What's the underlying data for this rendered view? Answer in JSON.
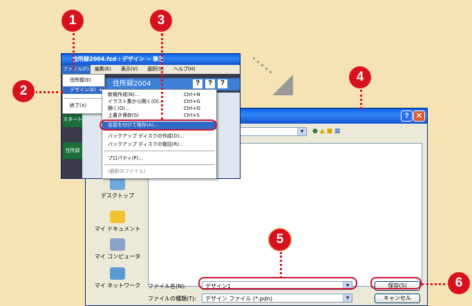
{
  "colors": {
    "background": "#f6e3b4",
    "accent_red": "#d8121c",
    "titlebar_blue": "#1553d2"
  },
  "badges": [
    "1",
    "2",
    "3",
    "4",
    "5",
    "6"
  ],
  "app": {
    "title": "住所録2004.fzd : デザイン − 筆王",
    "menubar": [
      "ファイル(F)",
      "編集(E)",
      "表示(V)",
      "選択(S)",
      "ヘルプ(H)"
    ],
    "brand": "住所録2004",
    "sidebar": [
      "スタート",
      "住所録"
    ]
  },
  "file_menu": {
    "items": [
      "住所録(E)",
      "デザイン(E)",
      "終了(X)"
    ]
  },
  "submenu": {
    "items": [
      {
        "label": "新規作成(N)...",
        "shortcut": "Ctrl+N"
      },
      {
        "label": "イラスト集から開く(O)...",
        "shortcut": "Ctrl+G"
      },
      {
        "label": "開く(O)...",
        "shortcut": "Ctrl+O"
      },
      {
        "label": "上書き保存(S)",
        "shortcut": "Ctrl+S"
      },
      {
        "label": "名前を付けて保存(A)...",
        "shortcut": ""
      },
      {
        "label": "バックアップ ディスクの作成(D)...",
        "shortcut": ""
      },
      {
        "label": "バックアップ ディスクの復旧(R)...",
        "shortcut": ""
      },
      {
        "label": "プロパティ(P)...",
        "shortcut": ""
      },
      {
        "label": "(最新のファイル)",
        "shortcut": ""
      }
    ]
  },
  "dialog": {
    "places": [
      "デスクトップ",
      "マイ ドキュメント",
      "マイ コンピュータ",
      "マイ ネットワーク"
    ],
    "filename_label": "ファイル名(N):",
    "filename_value": "デザイン1",
    "filetype_label": "ファイルの種類(T):",
    "filetype_value": "デザイン ファイル (*.pdn)",
    "save_button": "保存(S)",
    "cancel_button": "キャンセル"
  }
}
